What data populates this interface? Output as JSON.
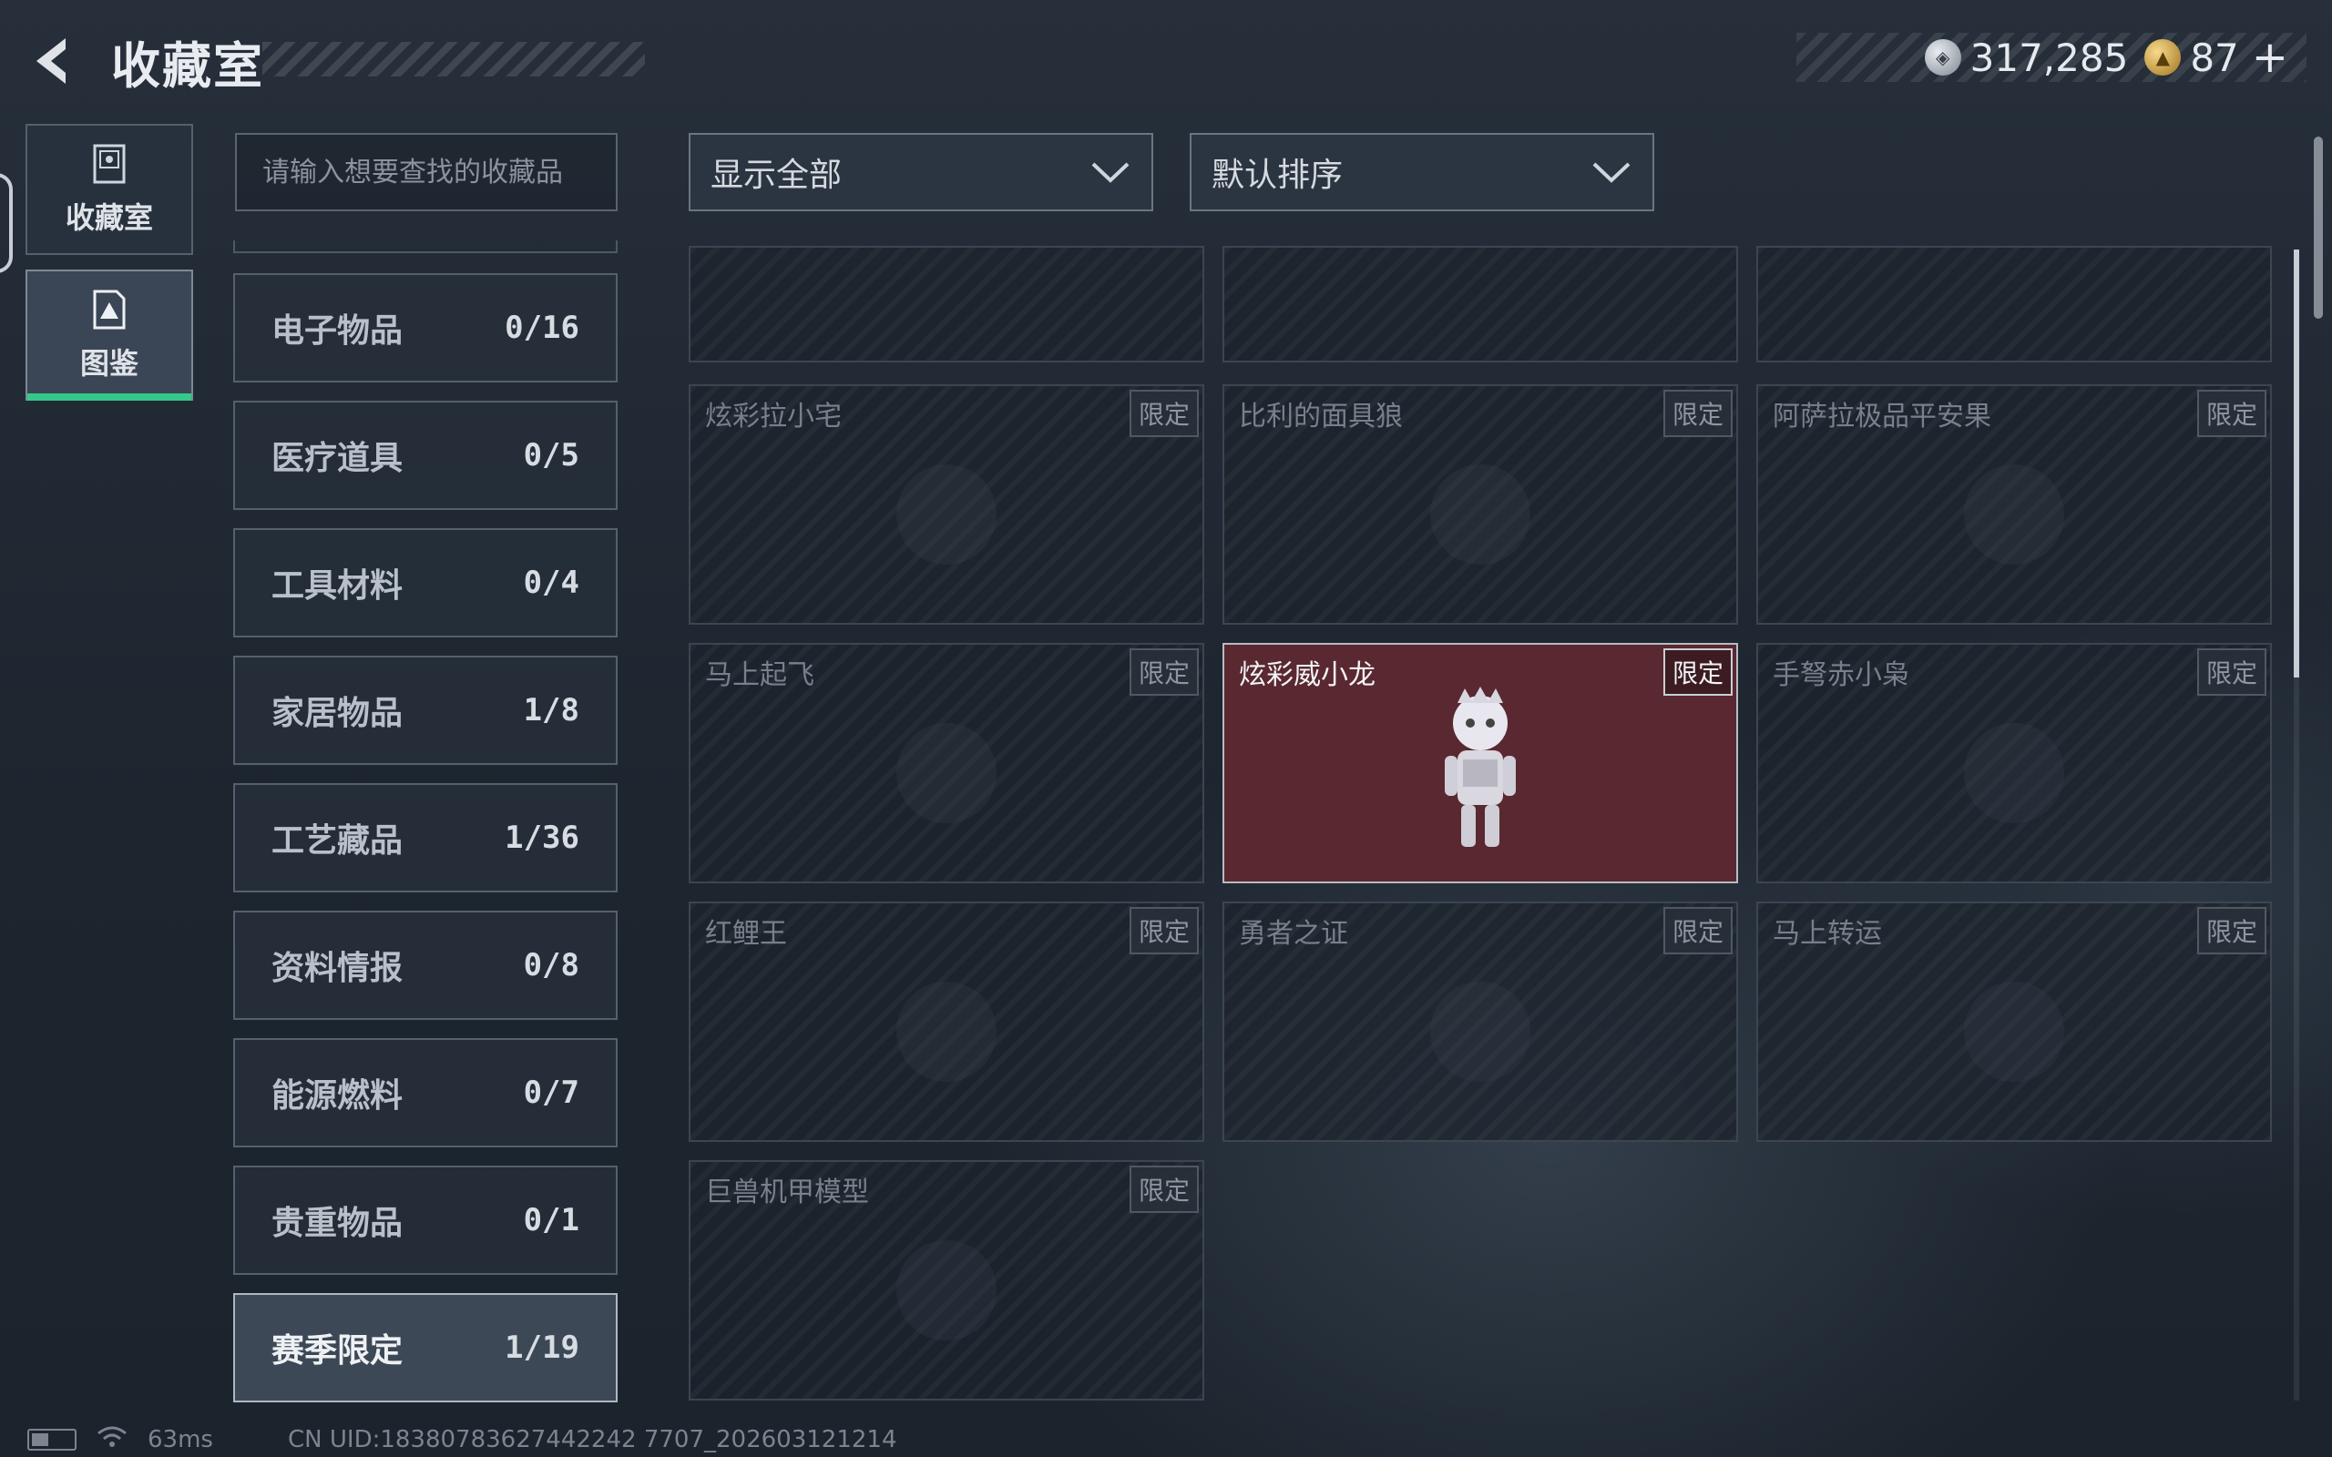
{
  "header": {
    "title": "收藏室",
    "currencies": [
      {
        "icon": "silver-coin-icon",
        "value": "317,285"
      },
      {
        "icon": "gold-coin-icon",
        "value": "87"
      }
    ],
    "plus_label": "+"
  },
  "rail": {
    "tabs": [
      {
        "label": "收藏室",
        "icon": "cabinet-icon",
        "active": false
      },
      {
        "label": "图鉴",
        "icon": "codex-icon",
        "active": true
      }
    ]
  },
  "search": {
    "placeholder": "请输入想要查找的收藏品"
  },
  "categories": [
    {
      "name": "电子物品",
      "count": "0/16"
    },
    {
      "name": "医疗道具",
      "count": "0/5"
    },
    {
      "name": "工具材料",
      "count": "0/4"
    },
    {
      "name": "家居物品",
      "count": "1/8"
    },
    {
      "name": "工艺藏品",
      "count": "1/36"
    },
    {
      "name": "资料情报",
      "count": "0/8"
    },
    {
      "name": "能源燃料",
      "count": "0/7"
    },
    {
      "name": "贵重物品",
      "count": "0/1"
    },
    {
      "name": "赛季限定",
      "count": "1/19",
      "active": true
    }
  ],
  "filters": {
    "display": "显示全部",
    "sort": "默认排序"
  },
  "items": [
    {
      "name": "炫彩拉小宅",
      "badge": "限定",
      "owned": false
    },
    {
      "name": "比利的面具狼",
      "badge": "限定",
      "owned": false
    },
    {
      "name": "阿萨拉极品平安果",
      "badge": "限定",
      "owned": false
    },
    {
      "name": "马上起飞",
      "badge": "限定",
      "owned": false
    },
    {
      "name": "炫彩威小龙",
      "badge": "限定",
      "owned": true
    },
    {
      "name": "手弩赤小枭",
      "badge": "限定",
      "owned": false
    },
    {
      "name": "红鲤王",
      "badge": "限定",
      "owned": false
    },
    {
      "name": "勇者之证",
      "badge": "限定",
      "owned": false
    },
    {
      "name": "马上转运",
      "badge": "限定",
      "owned": false
    },
    {
      "name": "巨兽机甲模型",
      "badge": "限定",
      "owned": false
    }
  ],
  "status": {
    "latency": "63ms",
    "uid": "CN UID:18380783627442242 7707_202603121214"
  },
  "colors": {
    "active_accent": "#35c889",
    "owned_card": "#5a2830"
  }
}
